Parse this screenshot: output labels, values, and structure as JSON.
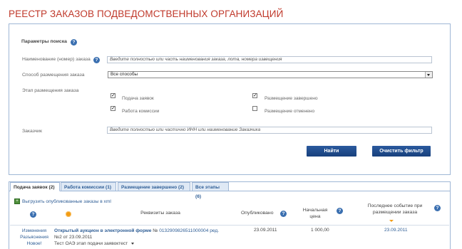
{
  "page_title": "РЕЕСТР ЗАКАЗОВ ПОДВЕДОМСТВЕННЫХ ОРГАНИЗАЦИЙ",
  "search": {
    "section_title": "Параметры поиска",
    "name_label": "Наименование (номер) заказа",
    "name_placeholder": "Введите полностью или часть наименования заказа, лота, номера извещения",
    "method_label": "Способ размещения заказа",
    "method_value": "Все способы",
    "stage_label": "Этап размещения заказа",
    "stages": [
      {
        "label": "Подача заявок",
        "checked": true
      },
      {
        "label": "Размещение завершено",
        "checked": true
      },
      {
        "label": "Работа комиссии",
        "checked": true
      },
      {
        "label": "Размещение отменено",
        "checked": false
      }
    ],
    "customer_label": "Заказчик",
    "customer_placeholder": "Введите полностью или частично ИНН или наименование Заказчика",
    "find_button": "Найти",
    "clear_button": "Очистить фильтр"
  },
  "tabs": [
    {
      "label": "Подача заявок (2)"
    },
    {
      "label": "Работа комиссии (1)"
    },
    {
      "label": "Размещение завершено (2)"
    },
    {
      "label": "Все этапы (6)"
    }
  ],
  "export_link": "Выгрузить опубликованные заказы в xml",
  "table": {
    "headers": {
      "details": "Реквизиты заказа",
      "published": "Опубликовано",
      "price": "Начальная цена",
      "last_event": "Последнее событие при размещении заказа"
    },
    "row": {
      "flags": [
        "Изменения",
        "Разъяснения",
        "Новое!"
      ],
      "title": "Открытый аукцион в электронной форме",
      "number_prefix": "№",
      "number": "0132909826511000004 ред.",
      "edition": "№2 от 23.09.2011",
      "subtitle": "Тест ОАЭ этап подачи заявоктест",
      "published": "23.09.2011",
      "price": "1 000,00",
      "last_event": "23.09.2011"
    }
  },
  "colors": {
    "title": "#c0392b",
    "accent": "#2f5e96",
    "button": "#1f4d8e"
  }
}
